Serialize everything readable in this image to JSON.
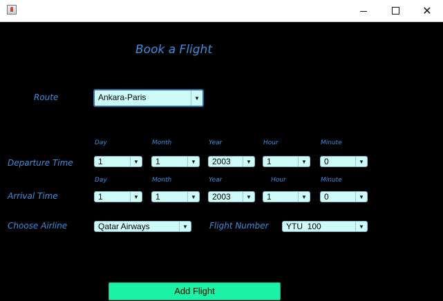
{
  "window": {
    "icon": "java-cup-icon",
    "controls": [
      "minimize-icon",
      "maximize-icon",
      "close-icon"
    ]
  },
  "title": "Book a Flight",
  "route": {
    "label": "Route",
    "value": "Ankara-Paris"
  },
  "departure": {
    "label": "Departure Time",
    "headers": {
      "day": "Day",
      "month": "Month",
      "year": "Year",
      "hour": "Hour",
      "minute": "Minute"
    },
    "day": "1",
    "month": "1",
    "year": "2003",
    "hour": "1",
    "minute": "0"
  },
  "arrival": {
    "label": "Arrival Time",
    "headers": {
      "day": "Day",
      "month": "Month",
      "year": "Year",
      "hour": "Hour",
      "minute": "Minute"
    },
    "day": "1",
    "month": "1",
    "year": "2003",
    "hour": "1",
    "minute": "0"
  },
  "airline": {
    "label": "Choose Airline",
    "value": "Qatar Airways"
  },
  "flight_number": {
    "label": "Flight Number",
    "value": "YTU  100"
  },
  "add_button": "Add Flight",
  "colors": {
    "background": "#000000",
    "label": "#3d8de0",
    "combo": "#cdfbf8",
    "button": "#1af2a5"
  }
}
